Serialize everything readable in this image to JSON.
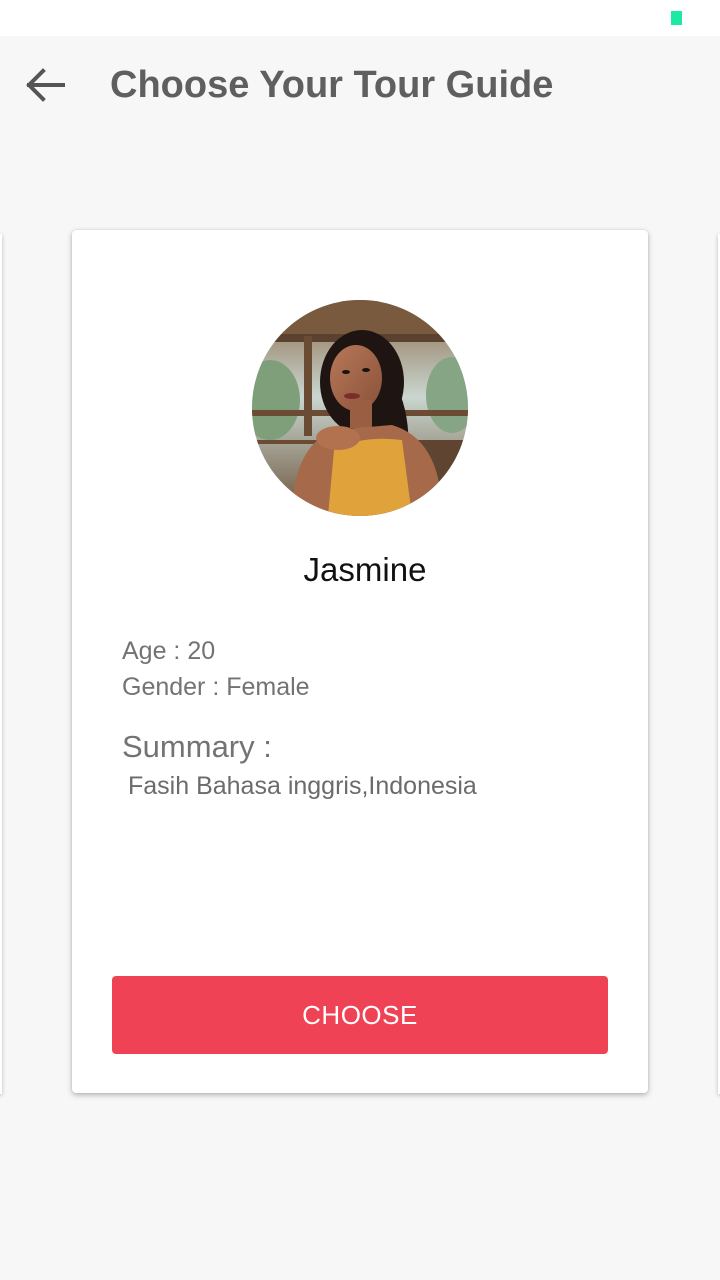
{
  "status_bar": {
    "indicator_color": "#1de9a6"
  },
  "toolbar": {
    "back_icon": "arrow-left-icon",
    "title": "Choose Your Tour Guide"
  },
  "guide": {
    "name": "Jasmine",
    "age_line": "Age : 20",
    "gender_line": "Gender : Female",
    "summary_heading": "Summary :",
    "summary_text": "Fasih Bahasa inggris,Indonesia"
  },
  "actions": {
    "choose_label": "CHOOSE",
    "choose_color": "#ef4255"
  }
}
